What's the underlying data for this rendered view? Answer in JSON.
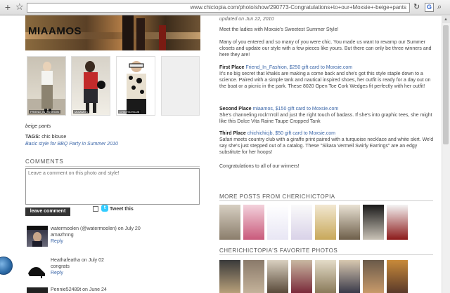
{
  "browser": {
    "url": "www.chictopia.com/photo/show/290773-Congratulations+to+our+Moxsie+-beige+pants",
    "google_glyph": "G"
  },
  "banner": {
    "name": "MIAAMOS"
  },
  "thumbnails": [
    {
      "caption": "FRIEND_IN_FASHION"
    },
    {
      "caption": "MIAAMOS"
    },
    {
      "caption": "CHICHICHICJB"
    }
  ],
  "photo_info": {
    "item": "beige pants",
    "tags_label": "TAGS:",
    "tags_value": "chic blouse",
    "description": "Basic style for BBQ Party in Summer 2010"
  },
  "comments": {
    "title": "COMMENTS",
    "placeholder": "Leave a comment on this photo and style!",
    "submit_label": "leave comment",
    "tweet_label": "Tweet this",
    "items": [
      {
        "author": "watermoolen (@watermoolen) on July 20",
        "text": "amazhnng",
        "reply": "Reply"
      },
      {
        "author": "Heathafeatha on July 02",
        "text": "congrats",
        "reply": "Reply"
      },
      {
        "author": "Pennie52489t on June 24",
        "text": "",
        "reply": ""
      }
    ]
  },
  "article": {
    "updated": "updated on Jun 22, 2010",
    "intro": "Meet the ladies with Moxsie's Sweetest Summer Style!",
    "body": "Many of you entered and so many of you were chic. You made us want to revamp our Summer closets and update our style with a few pieces like yours. But there can only be three winners and here they are!",
    "first_heading": "First Place",
    "first_winner": "Friend_In_Fashion, $250 gift card to Moxsie.com",
    "first_text": "It's no big secret that khakis are making a come back and she's got this style staple down to a science. Paired with a simple tank and nautical inspired shoes, her outfit is ready for a day out on the boat or a picnic in the park. These 8020 Open Toe Cork Wedges fit perfectly with her outfit!",
    "second_heading": "Second Place",
    "second_winner": "miaamos, $150 gift card to Moxsie.com",
    "second_text": "She's channeling rock'n'roll and just the right touch of badass. If she's into graphic tees, she might like this Dolce Vita Raine Taupe Cropped Tank",
    "third_heading": "Third Place",
    "third_winner": "chichichicjb, $50 gift card to Moxsie.com",
    "third_text": "Safari meets country club with a giraffe print paired with a turquoise necklace and white skirt. We'd say she's just stepped out of a catalog. These \"Sikara Vermeil Swirly Earrings\" are an edgy substitute for her hoops!",
    "closing": "Congratulations to all of our winners!"
  },
  "more_posts": {
    "title": "MORE POSTS FROM CHERICHICTOPIA"
  },
  "favorites": {
    "title": "CHERICHICTOPIA'S FAVORITE PHOTOS"
  }
}
